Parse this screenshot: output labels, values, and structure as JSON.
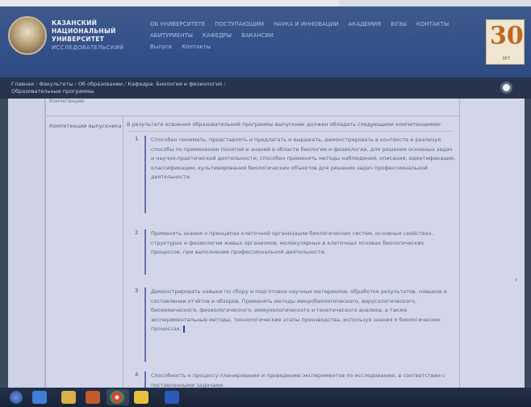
{
  "header": {
    "university_name": [
      "КАЗАНСКИЙ",
      "НАЦИОНАЛЬНЫЙ",
      "УНИВЕРСИТЕТ"
    ],
    "university_sub": "ИССЛЕДОВАТЕЛЬСКИЙ",
    "logo_caption": "",
    "nav_row1": [
      "ОБ УНИВЕРСИТЕТЕ",
      "ПОСТУПАЮЩИМ",
      "НАУКА И ИННОВАЦИИ",
      "АКАДЕМИЯ",
      "ВУЗЫ",
      "КОНТАКТЫ"
    ],
    "nav_row2": [
      "АБИТУРИЕНТЫ",
      "КАФЕДРЫ",
      "ВАКАНСИИ"
    ],
    "nav_row3": [
      "Выпуск",
      "Контакты"
    ],
    "badge_number": "30",
    "badge_label": "ЛЕТ"
  },
  "breadcrumb": {
    "path": [
      "Главная",
      "Факультеты",
      "Об образовании",
      "Кафедра: Биология и физиология",
      "Образовательные программы"
    ],
    "right_text": ""
  },
  "table": {
    "head_text": "Компетенции",
    "label": "Компетенции выпускника",
    "intro": "В результате освоения образовательной программы выпускник должен обладать следующими компетенциями:",
    "items": [
      {
        "num": "1",
        "text": "Способен понимать, представлять и предлагать и выражать, демонстрировать в контексте и реализуя способы по применению понятий и знаний в области биологии и физиологии, для решения основных задач и научно-практической деятельности; способен применять методы наблюдения, описания, идентификации, классификации, культивирования биологических объектов для решения задач профессиональной деятельности."
      },
      {
        "num": "2",
        "text": "Применять знания о принципах клеточной организации биологических систем, основных свойствах, структурах и физиологии живых организмов, молекулярных и клеточных основах биологических процессов, при выполнении профессиональной деятельности."
      },
      {
        "num": "3",
        "text": "Демонстрировать навыки по сбору и подготовке научных материалов, обработке результатов, навыков в составлении отчётов и обзоров.  Применять методы микробиологического, вирусологического, биохимического, физиологического, иммунологического и генетического анализа, а также экспериментальные методы, технологические этапы производства, используя знания о биологических процессах."
      },
      {
        "num": "4",
        "text": "Способность к процессу планирования и проведению экспериментов по исследованию, в соответствии с поставленными задачами."
      }
    ]
  },
  "taskbar": {
    "icons": [
      "start-icon",
      "internet-explorer-icon",
      "folder-icon",
      "media-player-icon",
      "chrome-icon",
      "yandex-icon",
      "word-icon"
    ]
  },
  "colors": {
    "header_bg": "#34508a",
    "crumb_bg": "#27344d",
    "page_bg": "#d3d6e8",
    "cursor": "#2b3fd0",
    "badge_accent": "#c0661e"
  }
}
